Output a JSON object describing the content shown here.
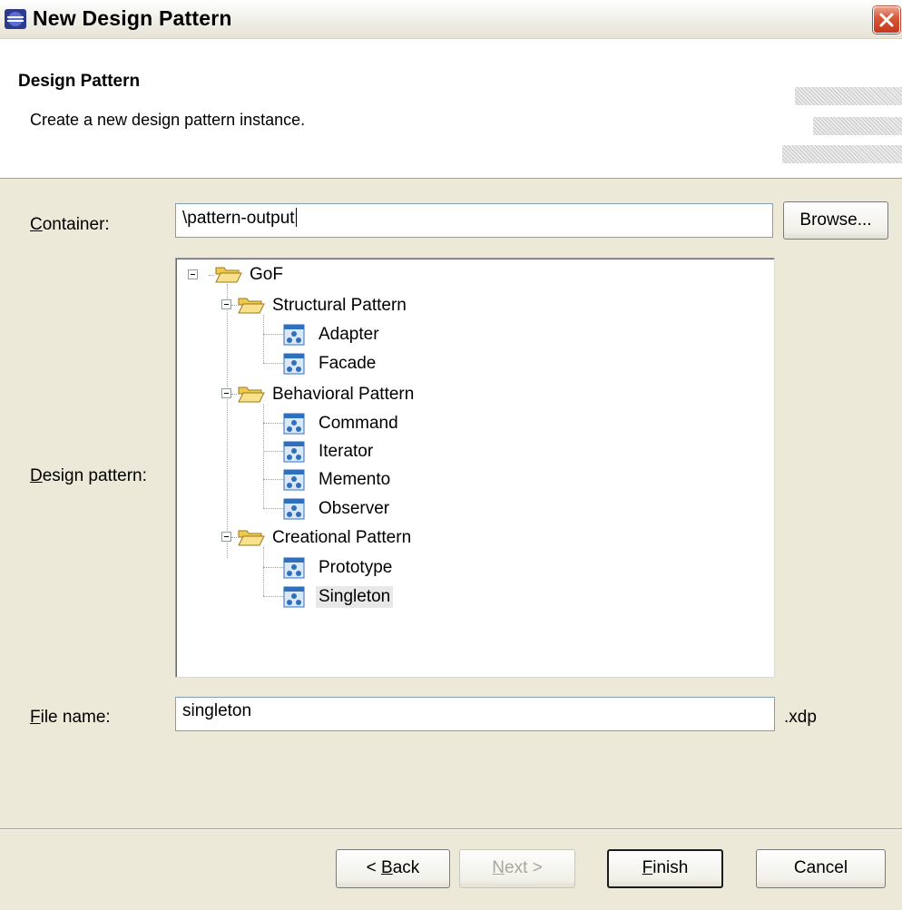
{
  "window": {
    "title": "New Design Pattern"
  },
  "banner": {
    "title": "Design Pattern",
    "description": "Create a new design pattern instance."
  },
  "container": {
    "label_mnemonic": "C",
    "label_rest": "ontainer:",
    "value": "\\pattern-output",
    "browse_label": "Browse..."
  },
  "design_pattern": {
    "label_mnemonic": "D",
    "label_rest": "esign pattern:",
    "tree": {
      "root": "GoF",
      "groups": [
        {
          "label": "Structural Pattern",
          "items": [
            "Adapter",
            "Facade"
          ]
        },
        {
          "label": "Behavioral Pattern",
          "items": [
            "Command",
            "Iterator",
            "Memento",
            "Observer"
          ]
        },
        {
          "label": "Creational Pattern",
          "items": [
            "Prototype",
            "Singleton"
          ]
        }
      ],
      "selected": "Singleton"
    }
  },
  "file_name": {
    "label_mnemonic": "F",
    "label_rest": "ile name:",
    "value": "singleton",
    "extension": ".xdp"
  },
  "buttons": {
    "back_prefix": "< ",
    "back_mnemonic": "B",
    "back_rest": "ack",
    "next_mnemonic": "N",
    "next_rest": "ext >",
    "finish_mnemonic": "F",
    "finish_rest": "inish",
    "cancel": "Cancel"
  },
  "icons": {
    "app": "eclipse-app-icon",
    "close": "close-icon",
    "folder": "open-folder-icon",
    "pattern": "pattern-diagram-icon",
    "expander": "collapse-minus-icon"
  },
  "colors": {
    "dialog_bg": "#ece9d8",
    "close_button": "#d9583a",
    "field_border": "#7f9db9",
    "folder": "#f5d97a",
    "pattern_icon": "#2f6fbf"
  }
}
